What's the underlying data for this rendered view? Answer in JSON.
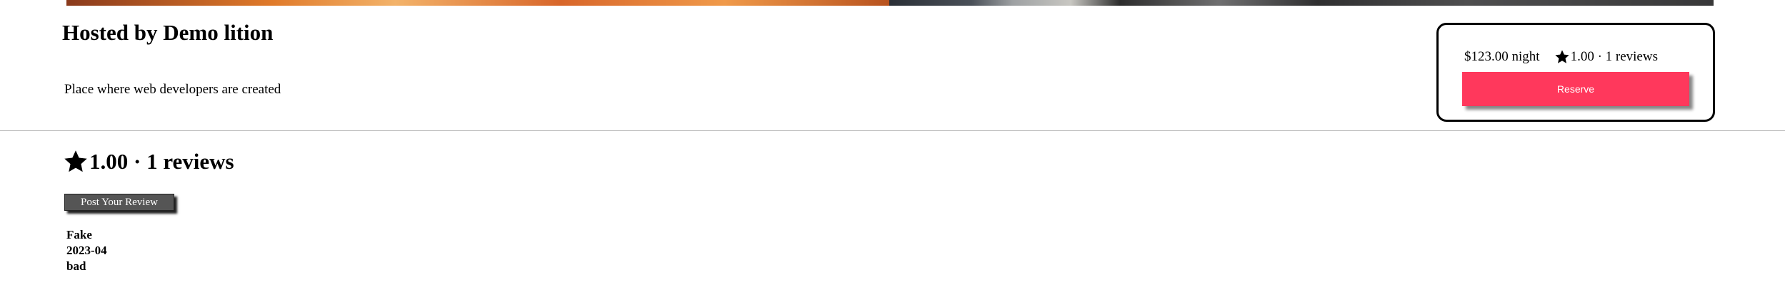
{
  "listing": {
    "host_title": "Hosted by Demo lition",
    "description": "Place where web developers are created"
  },
  "booking": {
    "price": "$123.00 night",
    "rating_text": "1.00 · 1 reviews",
    "reserve_label": "Reserve",
    "accent_color": "#ff385c"
  },
  "reviews_section": {
    "rating_heading": "1.00 · 1 reviews",
    "post_review_label": "Post Your Review",
    "items": [
      {
        "author": "Fake",
        "date": "2023-04",
        "text": "bad"
      }
    ]
  },
  "icons": {
    "rating_star": "star-icon"
  }
}
